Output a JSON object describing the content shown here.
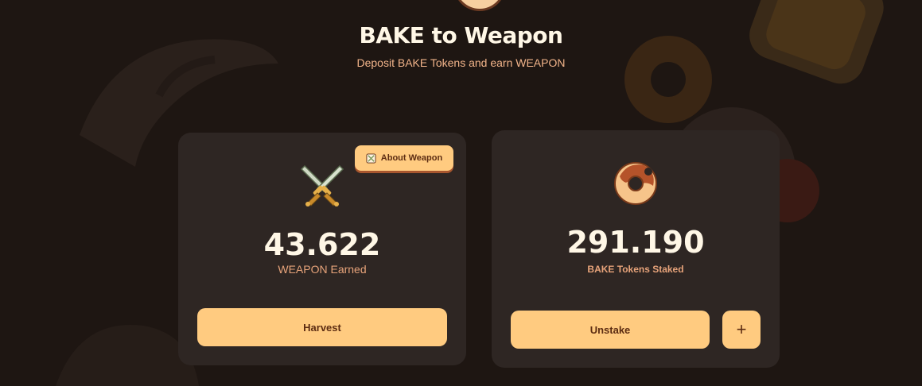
{
  "header": {
    "title": "BAKE to Weapon",
    "subtitle": "Deposit BAKE Tokens and earn WEAPON",
    "logo_icon": "bakery-logo-icon"
  },
  "earn_card": {
    "about_label": "About Weapon",
    "icon": "crossed-swords-icon",
    "value": "43.622",
    "label": "WEAPON Earned",
    "harvest_label": "Harvest"
  },
  "stake_card": {
    "icon": "donut-icon",
    "value": "291.190",
    "label": "BAKE Tokens Staked",
    "unstake_label": "Unstake",
    "add_label": "+"
  },
  "colors": {
    "background": "#1e1612",
    "card": "#2e2623",
    "accent": "#ffcb80",
    "accent_text": "#5c2c12",
    "subtitle": "#f2b48a"
  }
}
